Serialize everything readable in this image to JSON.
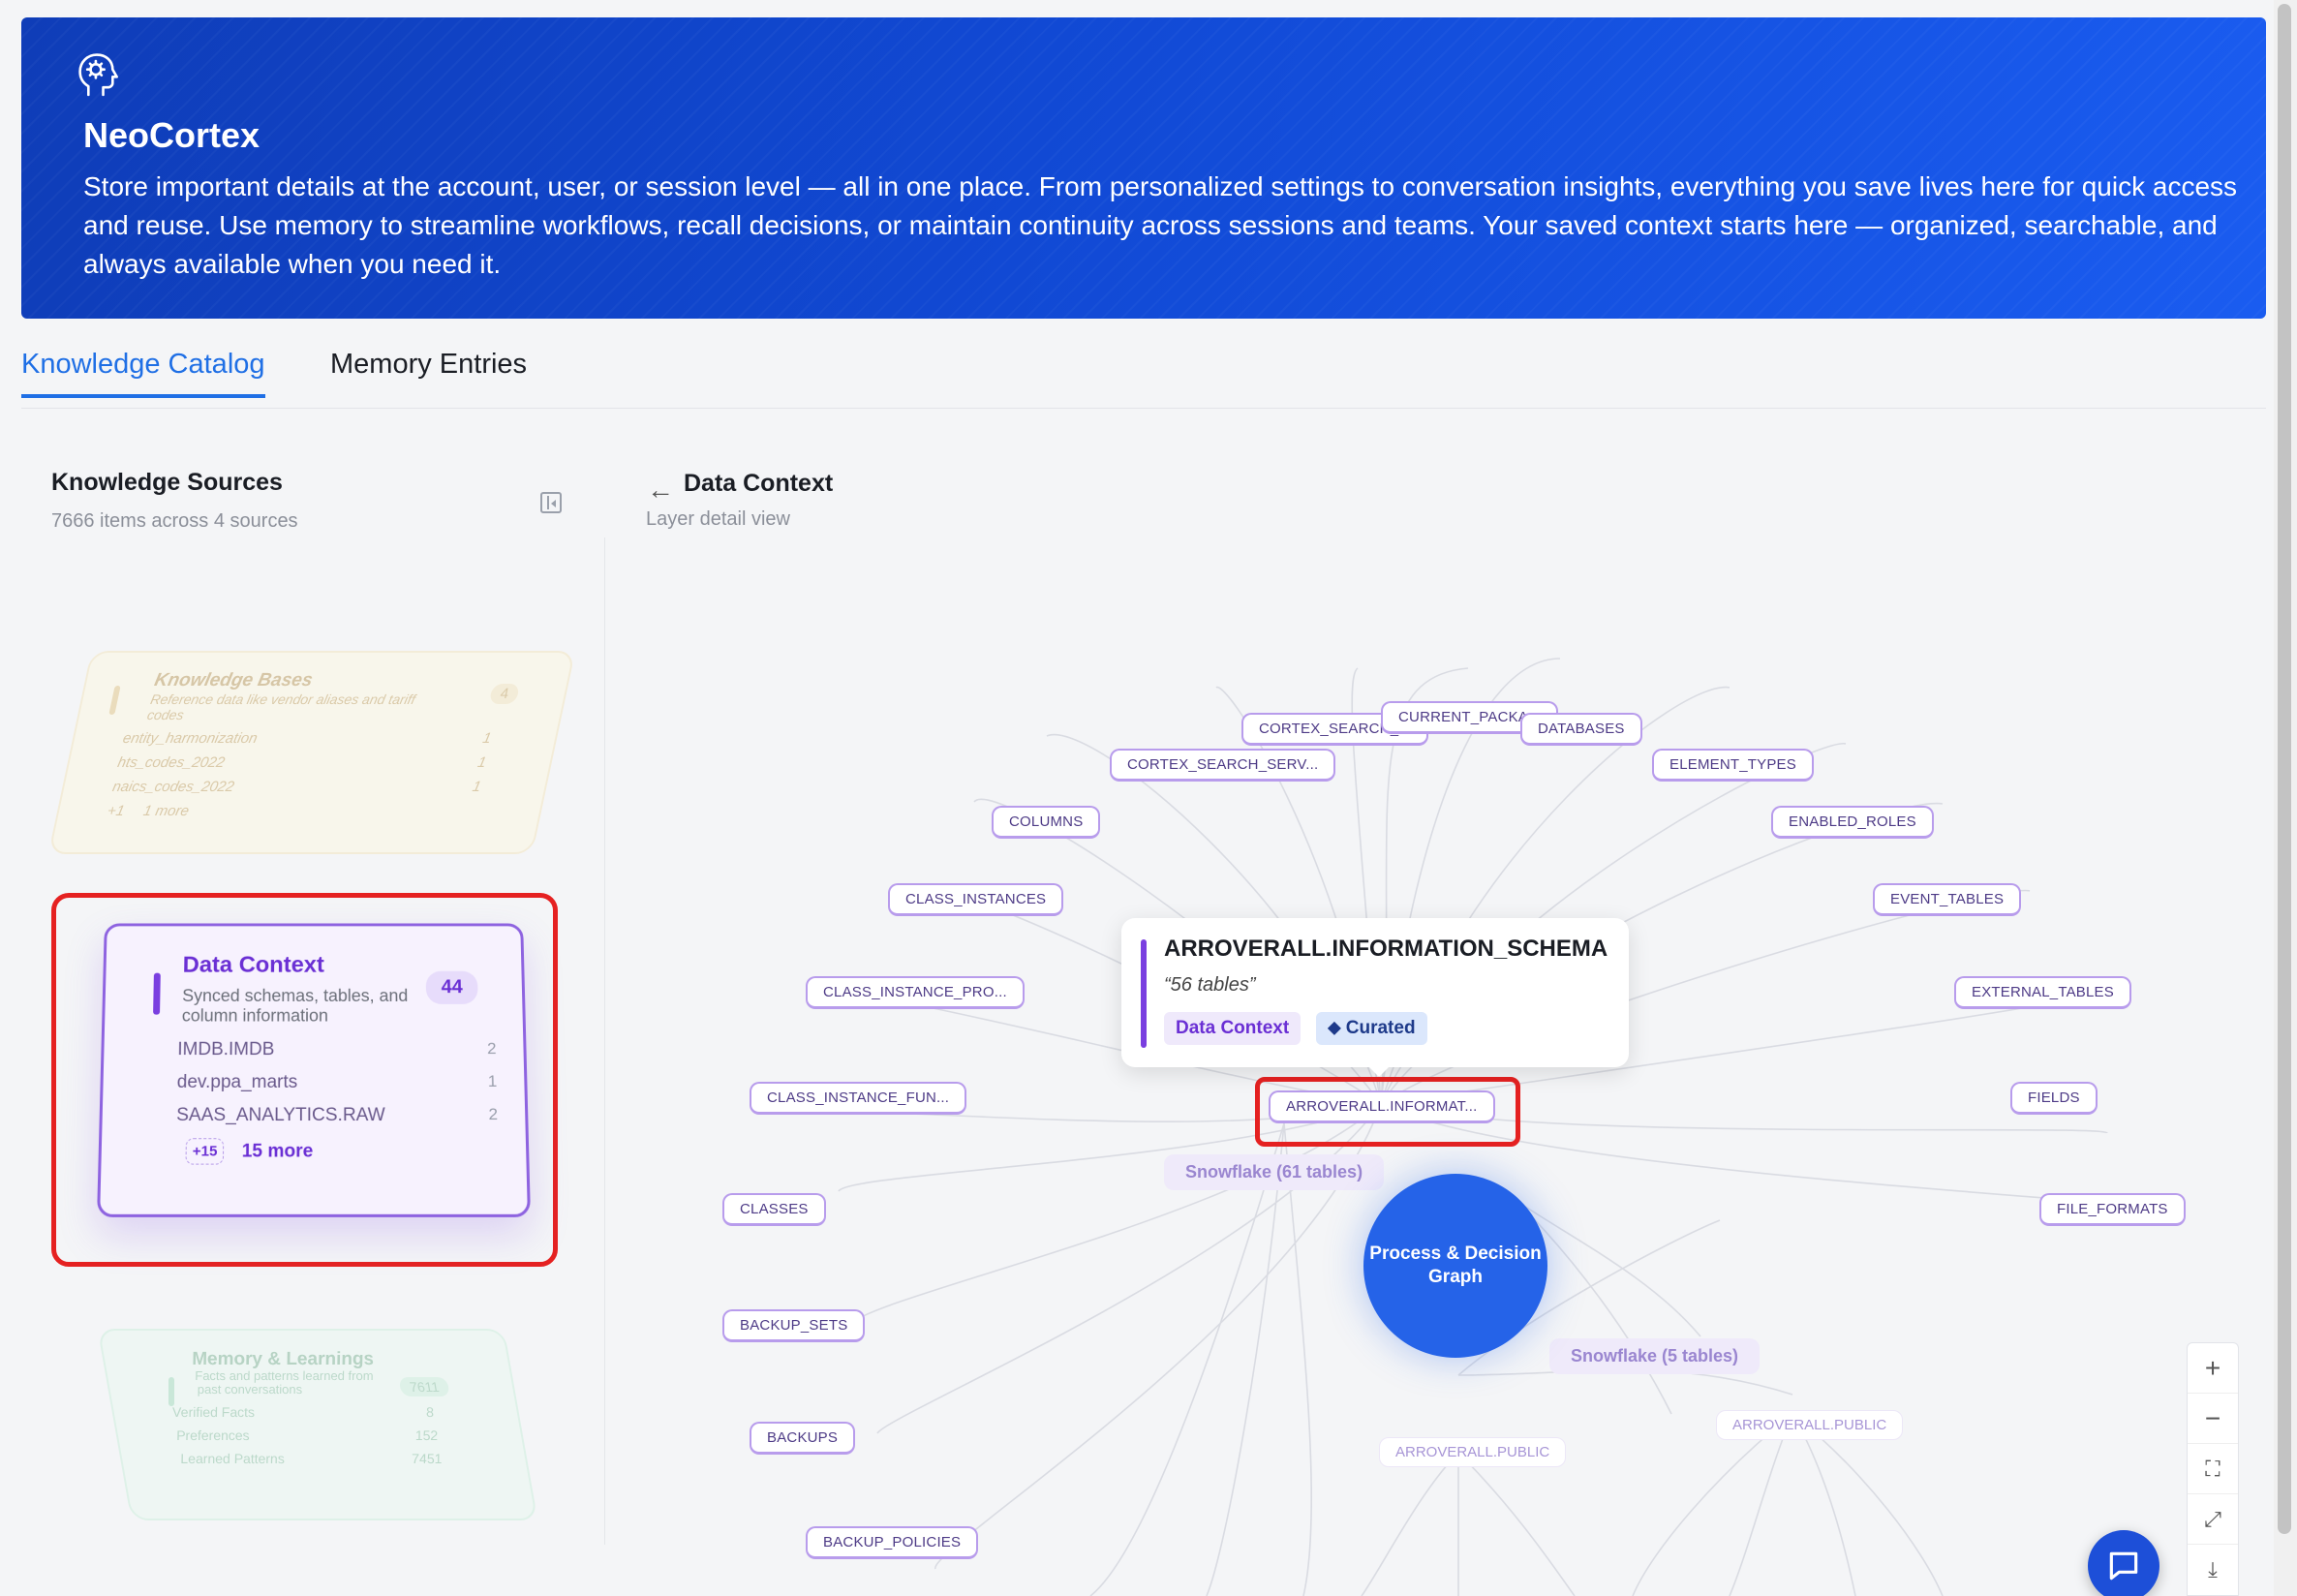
{
  "hero": {
    "title": "NeoCortex",
    "description": "Store important details at the account, user, or session level — all in one place. From personalized settings to conversation insights, everything you save lives here for quick access and reuse. Use memory to streamline workflows, recall decisions, or maintain continuity across sessions and teams. Your saved context starts here — organized, searchable, and always available when you need it.",
    "icon": "brain-head-icon"
  },
  "tabs": [
    {
      "label": "Knowledge Catalog",
      "active": true
    },
    {
      "label": "Memory Entries",
      "active": false
    }
  ],
  "left": {
    "title": "Knowledge Sources",
    "subtitle": "7666 items across 4 sources",
    "cards": {
      "kb": {
        "title": "Knowledge Bases",
        "subtitle": "Reference data like vendor aliases and tariff codes",
        "count": "4",
        "rows": [
          {
            "name": "entity_harmonization",
            "n": "1"
          },
          {
            "name": "hts_codes_2022",
            "n": "1"
          },
          {
            "name": "naics_codes_2022",
            "n": "1"
          }
        ],
        "more_badge": "+1",
        "more_label": "1 more"
      },
      "dc": {
        "title": "Data Context",
        "subtitle": "Synced schemas, tables, and column information",
        "count": "44",
        "rows": [
          {
            "name": "IMDB.IMDB",
            "n": "2"
          },
          {
            "name": "dev.ppa_marts",
            "n": "1"
          },
          {
            "name": "SAAS_ANALYTICS.RAW",
            "n": "2"
          }
        ],
        "more_badge": "+15",
        "more_label": "15 more"
      },
      "ml": {
        "title": "Memory & Learnings",
        "subtitle": "Facts and patterns learned from past conversations",
        "count": "7611",
        "rows": [
          {
            "name": "Verified Facts",
            "n": "8"
          },
          {
            "name": "Preferences",
            "n": "152"
          },
          {
            "name": "Learned Patterns",
            "n": "7451"
          }
        ]
      }
    }
  },
  "right": {
    "title": "Data Context",
    "subtitle": "Layer detail view",
    "center_label": "Process & Decision Graph",
    "pill1": "Snowflake (61 tables)",
    "pill2": "Snowflake (5 tables)",
    "public1": "ARROVERALL.PUBLIC",
    "public2": "ARROVERALL.PUBLIC",
    "highlight_node": "ARROVERALL.INFORMAT...",
    "tooltip": {
      "title": "ARROVERALL.INFORMATION_SCHEMA",
      "subtitle": "“56 tables”",
      "tag1": "Data Context",
      "tag2": "⬥ Curated"
    },
    "nodes": {
      "cortex_search": "CORTEX_SEARCH_...",
      "current_packa": "CURRENT_PACKA...",
      "databases": "DATABASES",
      "cortex_search_serv": "CORTEX_SEARCH_SERV...",
      "element_types": "ELEMENT_TYPES",
      "columns": "COLUMNS",
      "enabled_roles": "ENABLED_ROLES",
      "class_instances": "CLASS_INSTANCES",
      "event_tables": "EVENT_TABLES",
      "class_instance_pro": "CLASS_INSTANCE_PRO...",
      "external_tables": "EXTERNAL_TABLES",
      "class_instance_fun": "CLASS_INSTANCE_FUN...",
      "fields": "FIELDS",
      "classes": "CLASSES",
      "file_formats": "FILE_FORMATS",
      "backup_sets": "BACKUP_SETS",
      "backups": "BACKUPS",
      "backup_policies": "BACKUP_POLICIES"
    }
  },
  "zoom": {
    "in": "+",
    "out": "−",
    "fit": "⛶",
    "expand": "⤢",
    "download": "⤓"
  }
}
